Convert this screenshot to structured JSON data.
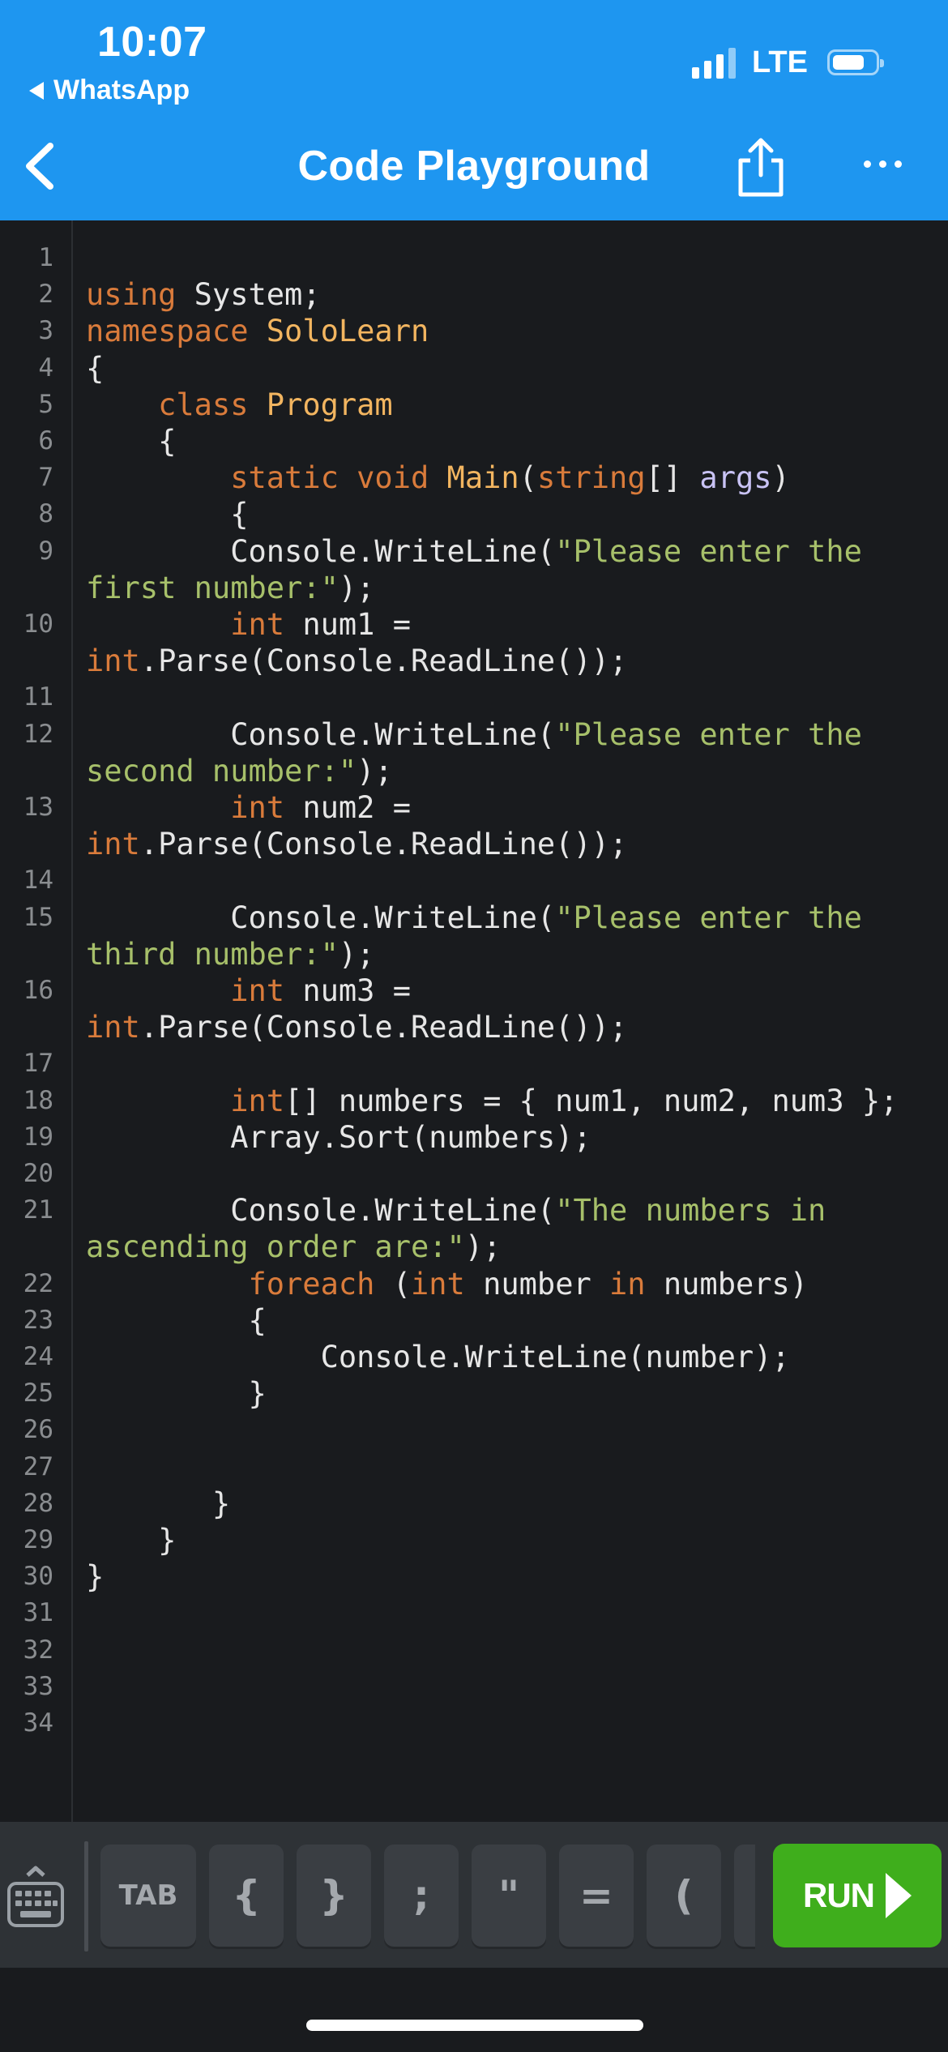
{
  "status_bar": {
    "time": "10:07",
    "back_app": "WhatsApp",
    "network": "LTE"
  },
  "header": {
    "title": "Code Playground",
    "back_icon": "chevron-left-icon",
    "share_icon": "share-icon",
    "more_icon": "more-icon"
  },
  "colors": {
    "header": "#1e96f0",
    "editor_bg": "#191b1e",
    "keyword": "#d97b3b",
    "class_name": "#f2b560",
    "string": "#a7c06a",
    "run_button": "#3fae1c"
  },
  "editor": {
    "line_numbers": [
      "1",
      "2",
      "3",
      "4",
      "5",
      "6",
      "7",
      "8",
      "9",
      "10",
      "11",
      "12",
      "13",
      "14",
      "15",
      "16",
      "17",
      "18",
      "19",
      "20",
      "21",
      "22",
      "23",
      "24",
      "25",
      "26",
      "27",
      "28",
      "29",
      "30",
      "31",
      "32",
      "33",
      "34"
    ],
    "rows": [
      {
        "n": "1",
        "tokens": []
      },
      {
        "n": "2",
        "tokens": [
          {
            "t": "using",
            "c": "kw"
          },
          {
            "t": " System;"
          }
        ]
      },
      {
        "n": "3",
        "tokens": [
          {
            "t": "namespace",
            "c": "kw"
          },
          {
            "t": " "
          },
          {
            "t": "SoloLearn",
            "c": "cls"
          }
        ]
      },
      {
        "n": "4",
        "tokens": [
          {
            "t": "{"
          }
        ]
      },
      {
        "n": "5",
        "tokens": [
          {
            "t": "    "
          },
          {
            "t": "class",
            "c": "kw"
          },
          {
            "t": " "
          },
          {
            "t": "Program",
            "c": "cls"
          }
        ]
      },
      {
        "n": "6",
        "tokens": [
          {
            "t": "    {"
          }
        ]
      },
      {
        "n": "7",
        "tokens": [
          {
            "t": "        "
          },
          {
            "t": "static",
            "c": "kw"
          },
          {
            "t": " "
          },
          {
            "t": "void",
            "c": "kw"
          },
          {
            "t": " "
          },
          {
            "t": "Main",
            "c": "cls"
          },
          {
            "t": "("
          },
          {
            "t": "string",
            "c": "kw"
          },
          {
            "t": "[] "
          },
          {
            "t": "args",
            "c": "prm"
          },
          {
            "t": ")"
          }
        ]
      },
      {
        "n": "8",
        "tokens": [
          {
            "t": "        {"
          }
        ]
      },
      {
        "n": "9",
        "tokens": [
          {
            "t": "        Console.WriteLine("
          },
          {
            "t": "\"Please enter the",
            "c": "str"
          }
        ]
      },
      {
        "n": "",
        "tokens": [
          {
            "t": "first number:\"",
            "c": "str"
          },
          {
            "t": ");"
          }
        ]
      },
      {
        "n": "10",
        "tokens": [
          {
            "t": "        "
          },
          {
            "t": "int",
            "c": "kw"
          },
          {
            "t": " num1 ="
          }
        ]
      },
      {
        "n": "",
        "tokens": [
          {
            "t": "int",
            "c": "kw"
          },
          {
            "t": ".Parse(Console.ReadLine());"
          }
        ]
      },
      {
        "n": "11",
        "tokens": []
      },
      {
        "n": "12",
        "tokens": [
          {
            "t": "        Console.WriteLine("
          },
          {
            "t": "\"Please enter the",
            "c": "str"
          }
        ]
      },
      {
        "n": "",
        "tokens": [
          {
            "t": "second number:\"",
            "c": "str"
          },
          {
            "t": ");"
          }
        ]
      },
      {
        "n": "13",
        "tokens": [
          {
            "t": "        "
          },
          {
            "t": "int",
            "c": "kw"
          },
          {
            "t": " num2 ="
          }
        ]
      },
      {
        "n": "",
        "tokens": [
          {
            "t": "int",
            "c": "kw"
          },
          {
            "t": ".Parse(Console.ReadLine());"
          }
        ]
      },
      {
        "n": "14",
        "tokens": []
      },
      {
        "n": "15",
        "tokens": [
          {
            "t": "        Console.WriteLine("
          },
          {
            "t": "\"Please enter the",
            "c": "str"
          }
        ]
      },
      {
        "n": "",
        "tokens": [
          {
            "t": "third number:\"",
            "c": "str"
          },
          {
            "t": ");"
          }
        ]
      },
      {
        "n": "16",
        "tokens": [
          {
            "t": "        "
          },
          {
            "t": "int",
            "c": "kw"
          },
          {
            "t": " num3 ="
          }
        ]
      },
      {
        "n": "",
        "tokens": [
          {
            "t": "int",
            "c": "kw"
          },
          {
            "t": ".Parse(Console.ReadLine());"
          }
        ]
      },
      {
        "n": "17",
        "tokens": []
      },
      {
        "n": "18",
        "tokens": [
          {
            "t": "        "
          },
          {
            "t": "int",
            "c": "kw"
          },
          {
            "t": "[] numbers = { num1, num2, num3 };"
          }
        ]
      },
      {
        "n": "19",
        "tokens": [
          {
            "t": "        Array.Sort(numbers);"
          }
        ]
      },
      {
        "n": "20",
        "tokens": []
      },
      {
        "n": "21",
        "tokens": [
          {
            "t": "        Console.WriteLine("
          },
          {
            "t": "\"The numbers in",
            "c": "str"
          }
        ]
      },
      {
        "n": "",
        "tokens": [
          {
            "t": "ascending order are:\"",
            "c": "str"
          },
          {
            "t": ");"
          }
        ]
      },
      {
        "n": "22",
        "tokens": [
          {
            "t": "         "
          },
          {
            "t": "foreach",
            "c": "kw"
          },
          {
            "t": " ("
          },
          {
            "t": "int",
            "c": "kw"
          },
          {
            "t": " number "
          },
          {
            "t": "in",
            "c": "kw"
          },
          {
            "t": " numbers)"
          }
        ]
      },
      {
        "n": "23",
        "tokens": [
          {
            "t": "         {"
          }
        ]
      },
      {
        "n": "24",
        "tokens": [
          {
            "t": "             Console.WriteLine(number);"
          }
        ]
      },
      {
        "n": "25",
        "tokens": [
          {
            "t": "         }"
          }
        ]
      },
      {
        "n": "26",
        "tokens": []
      },
      {
        "n": "27",
        "tokens": []
      },
      {
        "n": "28",
        "tokens": [
          {
            "t": "       }"
          }
        ]
      },
      {
        "n": "29",
        "tokens": [
          {
            "t": "    }"
          }
        ]
      },
      {
        "n": "30",
        "tokens": [
          {
            "t": "}"
          }
        ]
      },
      {
        "n": "31",
        "tokens": []
      },
      {
        "n": "32",
        "tokens": []
      },
      {
        "n": "33",
        "tokens": []
      },
      {
        "n": "34",
        "tokens": []
      }
    ]
  },
  "toolbar": {
    "keyboard_icon": "keyboard-icon",
    "keys": [
      "TAB",
      "{",
      "}",
      ";",
      "\"",
      "=",
      "("
    ],
    "run_label": "RUN",
    "run_icon": "play-icon"
  }
}
